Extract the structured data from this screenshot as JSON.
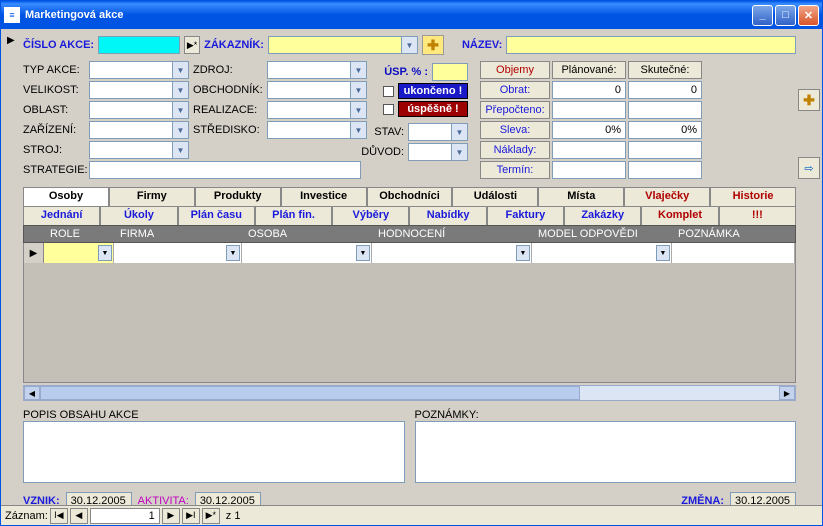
{
  "window": {
    "title": "Marketingová akce"
  },
  "top": {
    "cislo_akce_lbl": "ČÍSLO AKCE:",
    "zakaznik_lbl": "ZÁKAZNÍK:",
    "nazev_lbl": "NÁZEV:"
  },
  "left_labels": {
    "typ_akce": "TYP AKCE:",
    "zdroj": "ZDROJ:",
    "velikost": "VELIKOST:",
    "obchodnik": "OBCHODNÍK:",
    "oblast": "OBLAST:",
    "realizace": "REALIZACE:",
    "zarizeni": "ZAŘÍZENÍ:",
    "stredisko": "STŘEDISKO:",
    "stroj": "STROJ:",
    "stav": "STAV:",
    "strategie": "STRATEGIE:",
    "duvod": "DŮVOD:"
  },
  "status": {
    "usp": "ÚSP. % :",
    "ukonceno": "ukončeno !",
    "uspesne": "úspěšně !"
  },
  "rtable": {
    "objemy": "Objemy",
    "planovane": "Plánované:",
    "skutecne": "Skutečné:",
    "obrat": "Obrat:",
    "obrat_p": "0",
    "obrat_s": "0",
    "prepocteno": "Přepočteno:",
    "sleva": "Sleva:",
    "sleva_p": "0%",
    "sleva_s": "0%",
    "naklady": "Náklady:",
    "termin": "Termín:"
  },
  "tabs1": [
    "Osoby",
    "Firmy",
    "Produkty",
    "Investice",
    "Obchodníci",
    "Události",
    "Místa",
    "Vlaječky",
    "Historie"
  ],
  "tabs2": [
    "Jednání",
    "Úkoly",
    "Plán času",
    "Plán fin.",
    "Výběry",
    "Nabídky",
    "Faktury",
    "Zakázky",
    "Komplet",
    "!!!"
  ],
  "grid": {
    "cols": [
      "ROLE",
      "FIRMA",
      "OSOBA",
      "HODNOCENÍ",
      "MODEL ODPOVĚDI",
      "POZNÁMKA"
    ]
  },
  "notes": {
    "popis": "POPIS OBSAHU AKCE",
    "poznamky": "POZNÁMKY:"
  },
  "dates": {
    "vznik_lbl": "VZNIK:",
    "vznik": "30.12.2005",
    "aktivita_lbl": "AKTIVITA:",
    "aktivita": "30.12.2005",
    "zmena_lbl": "ZMĚNA:",
    "zmena": "30.12.2005"
  },
  "record": {
    "label": "Záznam:",
    "num": "1",
    "of": "z  1"
  }
}
